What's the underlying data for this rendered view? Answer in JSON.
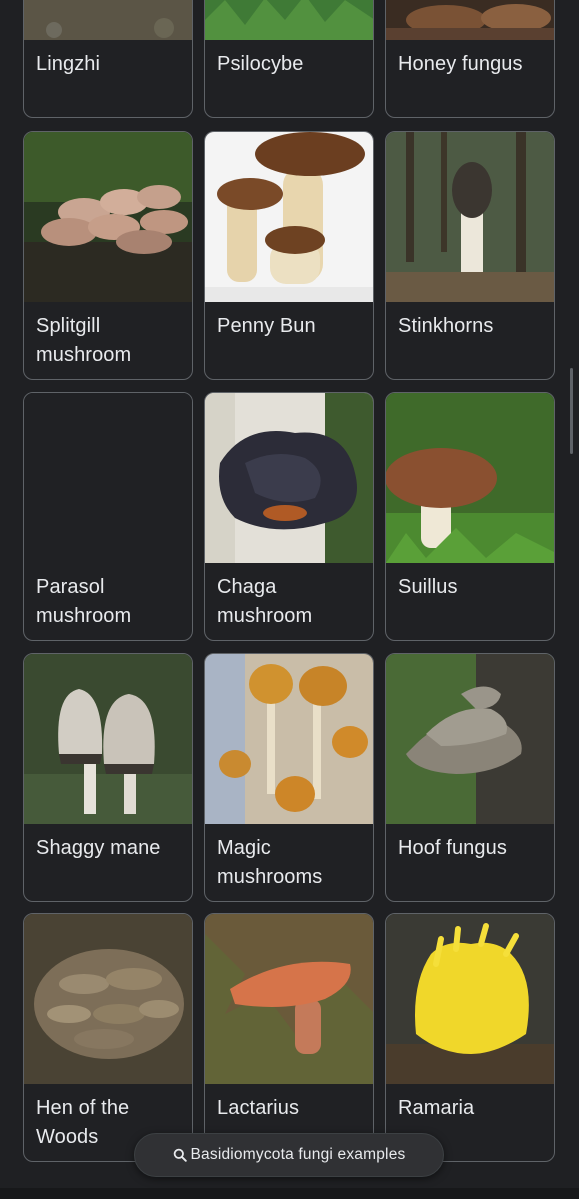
{
  "cards": [
    {
      "name": "Lingzhi",
      "lines": [
        "Lingzhi"
      ]
    },
    {
      "name": "Psilocybe",
      "lines": [
        "Psilocybe"
      ]
    },
    {
      "name": "Honey fungus",
      "lines": [
        "Honey fungus"
      ]
    },
    {
      "name": "Splitgill mushroom",
      "lines": [
        "Splitgill",
        "mushroom"
      ]
    },
    {
      "name": "Penny Bun",
      "lines": [
        "Penny Bun"
      ]
    },
    {
      "name": "Stinkhorns",
      "lines": [
        "Stinkhorns"
      ]
    },
    {
      "name": "Parasol mushroom",
      "lines": [
        "Parasol",
        "mushroom"
      ]
    },
    {
      "name": "Chaga mushroom",
      "lines": [
        "Chaga",
        "mushroom"
      ]
    },
    {
      "name": "Suillus",
      "lines": [
        "Suillus"
      ]
    },
    {
      "name": "Shaggy mane",
      "lines": [
        "Shaggy mane"
      ]
    },
    {
      "name": "Magic mushrooms",
      "lines": [
        "Magic",
        "mushrooms"
      ]
    },
    {
      "name": "Hoof fungus",
      "lines": [
        "Hoof fungus"
      ]
    },
    {
      "name": "Hen of the Woods",
      "lines": [
        "Hen of the",
        "Woods"
      ]
    },
    {
      "name": "Lactarius",
      "lines": [
        "Lactarius"
      ]
    },
    {
      "name": "Ramaria",
      "lines": [
        "Ramaria"
      ]
    }
  ],
  "search_chip": {
    "icon": "search-icon",
    "label": "Basidiomycota fungi examples"
  }
}
